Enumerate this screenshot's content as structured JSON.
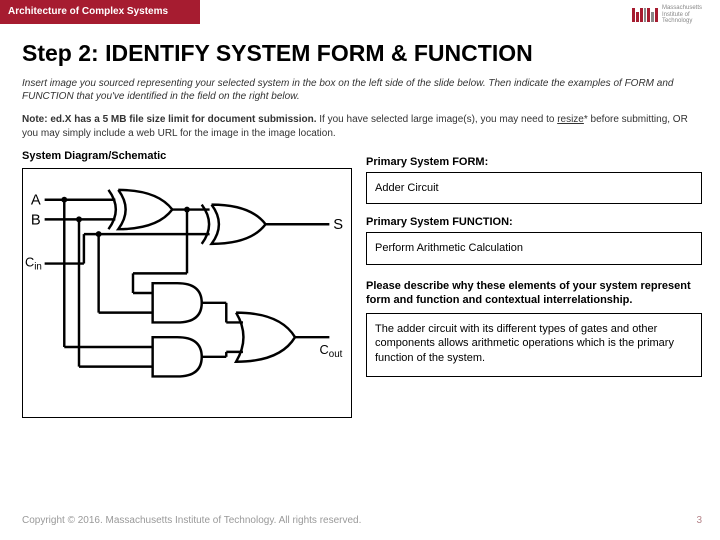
{
  "header": {
    "course_title": "Architecture of Complex Systems",
    "logo_text": "Massachusetts\nInstitute of\nTechnology"
  },
  "slide": {
    "title": "Step 2: IDENTIFY SYSTEM FORM & FUNCTION",
    "instructions": "Insert image you sourced representing your selected system in the box on the left side of the slide below. Then indicate the examples of FORM and FUNCTION that you've identified in the field on the right below.",
    "note_bold": "Note: ed.X has a 5 MB file size limit for document submission.",
    "note_rest": " If you have selected large image(s), you may need to ",
    "note_resize": "resize",
    "note_after": "* before submitting, OR you may simply include a web URL for the image in the image location."
  },
  "left": {
    "label": "System Diagram/Schematic",
    "inputs": [
      "A",
      "B",
      "Cin"
    ],
    "outputs": [
      "S",
      "Cout"
    ]
  },
  "right": {
    "form_label": "Primary System FORM:",
    "form_value": "Adder Circuit",
    "function_label": "Primary System FUNCTION:",
    "function_value": "Perform Arithmetic Calculation",
    "desc_label": "Please describe why these elements of your system represent form and function and contextual interrelationship.",
    "desc_value": "The adder circuit with its different types of gates and other components allows arithmetic operations which is the primary function of the system."
  },
  "footer": {
    "copyright": "Copyright © 2016. Massachusetts Institute of Technology. All rights reserved.",
    "page": "3"
  }
}
